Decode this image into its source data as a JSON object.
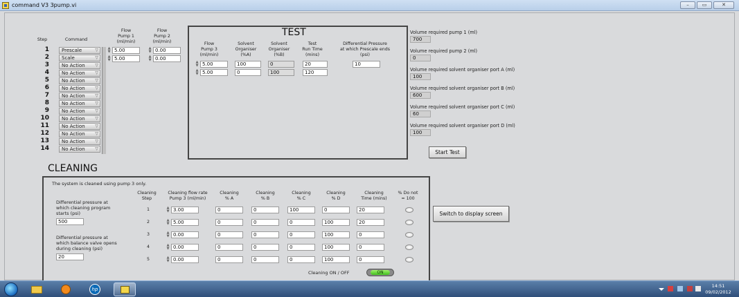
{
  "window": {
    "title": "command V3 3pump.vi"
  },
  "test": {
    "heading": "TEST",
    "col_step": "Step",
    "col_command": "Command",
    "col_flow_pump1": "Flow\nPump 1\n(ml/min)",
    "col_flow_pump2": "Flow\nPump 2\n(ml/min)",
    "col_flow_pump3": "Flow\nPump 3\n(ml/min)",
    "col_solvent_a": "Solvent\nOrganiser\n(%A)",
    "col_solvent_b": "Solvent\nOrganiser\n(%B)",
    "col_run_time": "Test\nRun Time\n(mins)",
    "col_diff_pressure": "Differential Pressure\nat which Prescale ends\n(psi)",
    "steps": [
      {
        "num": "1",
        "command": "Prescale"
      },
      {
        "num": "2",
        "command": "Scale"
      },
      {
        "num": "3",
        "command": "No Action"
      },
      {
        "num": "4",
        "command": "No Action"
      },
      {
        "num": "5",
        "command": "No Action"
      },
      {
        "num": "6",
        "command": "No Action"
      },
      {
        "num": "7",
        "command": "No Action"
      },
      {
        "num": "8",
        "command": "No Action"
      },
      {
        "num": "9",
        "command": "No Action"
      },
      {
        "num": "10",
        "command": "No Action"
      },
      {
        "num": "11",
        "command": "No Action"
      },
      {
        "num": "12",
        "command": "No Action"
      },
      {
        "num": "13",
        "command": "No Action"
      },
      {
        "num": "14",
        "command": "No Action"
      }
    ],
    "pump1": [
      "5.00",
      "5.00"
    ],
    "pump2": [
      "0.00",
      "0.00"
    ],
    "pump3": [
      "5.00",
      "5.00"
    ],
    "solvent_a": [
      "100",
      "0"
    ],
    "solvent_b": [
      "0",
      "100"
    ],
    "run_time": [
      "20",
      "120"
    ],
    "diff_pressure": "10"
  },
  "volumes": [
    {
      "label": "Volume required pump 1 (ml)",
      "value": "700"
    },
    {
      "label": "Volume required pump 2 (ml)",
      "value": "0"
    },
    {
      "label": "Volume required solvent organiser port A (ml)",
      "value": "100"
    },
    {
      "label": "Volume required solvent organiser port B (ml)",
      "value": "600"
    },
    {
      "label": "Volume required solvent organiser port C (ml)",
      "value": "60"
    },
    {
      "label": "Volume required solvent organiser port D (ml)",
      "value": "100"
    }
  ],
  "start_test_label": "Start Test",
  "cleaning": {
    "heading": "CLEANING",
    "note": "The system is cleaned using pump 3 only.",
    "diff_start_label": "Differential pressure at\nwhich cleaning program\nstarts (psi)",
    "diff_start_value": "500",
    "diff_balance_label": "Differential pressure at\nwhich balance valve opens\nduring cleaning (psi)",
    "diff_balance_value": "20",
    "col_step": "Cleaning\nStep",
    "col_flow": "Cleaning flow rate\nPump 3 (ml/min)",
    "col_a": "Cleaning\n% A",
    "col_b": "Cleaning\n% B",
    "col_c": "Cleaning\n% C",
    "col_d": "Cleaning\n% D",
    "col_time": "Cleaning\nTime (mins)",
    "col_not100": "% Do not\n= 100",
    "rows": [
      {
        "step": "1",
        "flow": "3.00",
        "a": "0",
        "b": "0",
        "c": "100",
        "d": "0",
        "time": "20"
      },
      {
        "step": "2",
        "flow": "5.00",
        "a": "0",
        "b": "0",
        "c": "0",
        "d": "100",
        "time": "20"
      },
      {
        "step": "3",
        "flow": "0.00",
        "a": "0",
        "b": "0",
        "c": "0",
        "d": "100",
        "time": "0"
      },
      {
        "step": "4",
        "flow": "0.00",
        "a": "0",
        "b": "0",
        "c": "0",
        "d": "100",
        "time": "0"
      },
      {
        "step": "5",
        "flow": "0.00",
        "a": "0",
        "b": "0",
        "c": "0",
        "d": "100",
        "time": "0"
      }
    ],
    "onoff_label": "Cleaning ON / OFF",
    "toggle_text": "ON"
  },
  "switch_display_label": "Switch to display screen",
  "taskbar": {
    "time": "14:51",
    "date": "09/02/2012"
  }
}
